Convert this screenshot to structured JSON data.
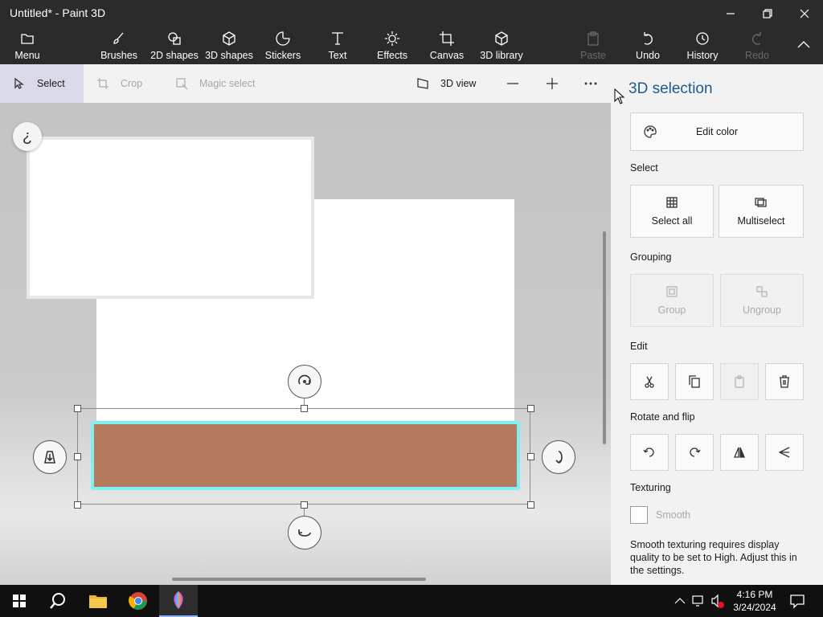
{
  "window": {
    "title": "Untitled* - Paint 3D"
  },
  "ribbon": {
    "menu": "Menu",
    "brushes": "Brushes",
    "shapes2d": "2D shapes",
    "shapes3d": "3D shapes",
    "stickers": "Stickers",
    "text": "Text",
    "effects": "Effects",
    "canvas": "Canvas",
    "library3d": "3D library",
    "paste": "Paste",
    "undo": "Undo",
    "history": "History",
    "redo": "Redo"
  },
  "toolbar": {
    "select": "Select",
    "crop": "Crop",
    "magic_select": "Magic select",
    "view3d": "3D view"
  },
  "canvas": {
    "help_glyph": "¿"
  },
  "panel": {
    "title": "3D selection",
    "edit_color": "Edit color",
    "select_heading": "Select",
    "select_all": "Select all",
    "multiselect": "Multiselect",
    "grouping_heading": "Grouping",
    "group": "Group",
    "ungroup": "Ungroup",
    "edit_heading": "Edit",
    "rotate_heading": "Rotate and flip",
    "texturing_heading": "Texturing",
    "smooth": "Smooth",
    "smooth_note": "Smooth texturing requires display quality to be set to High. Adjust this in the settings."
  },
  "taskbar": {
    "time": "4:16 PM",
    "date": "3/24/2024"
  },
  "colors": {
    "accent": "#1f5a8c",
    "object": "#b57a5e",
    "outline": "#7ff0f0"
  }
}
